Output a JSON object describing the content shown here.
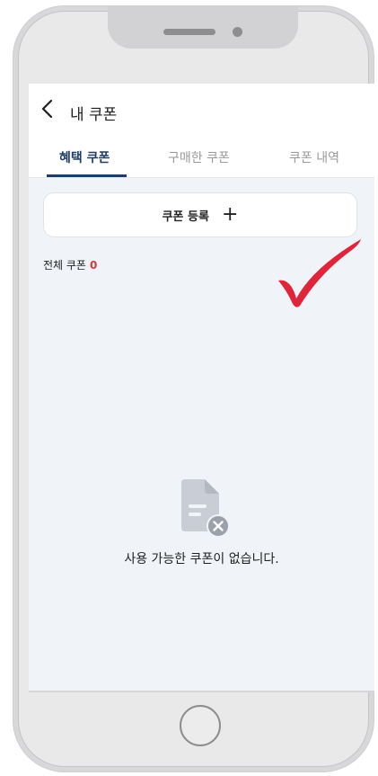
{
  "header": {
    "title": "내 쿠폰"
  },
  "tabs": [
    {
      "label": "혜택 쿠폰",
      "active": true
    },
    {
      "label": "구매한 쿠폰",
      "active": false
    },
    {
      "label": "쿠폰 내역",
      "active": false
    }
  ],
  "register": {
    "label": "쿠폰 등록",
    "icon": "plus-icon"
  },
  "summary": {
    "label": "전체 쿠폰",
    "count": "0"
  },
  "empty_state": {
    "message": "사용 가능한 쿠폰이 없습니다.",
    "icon": "empty-document-icon"
  },
  "colors": {
    "accent": "#1e3e66",
    "count": "#d63a3a",
    "checkmark": "#e0243a"
  }
}
